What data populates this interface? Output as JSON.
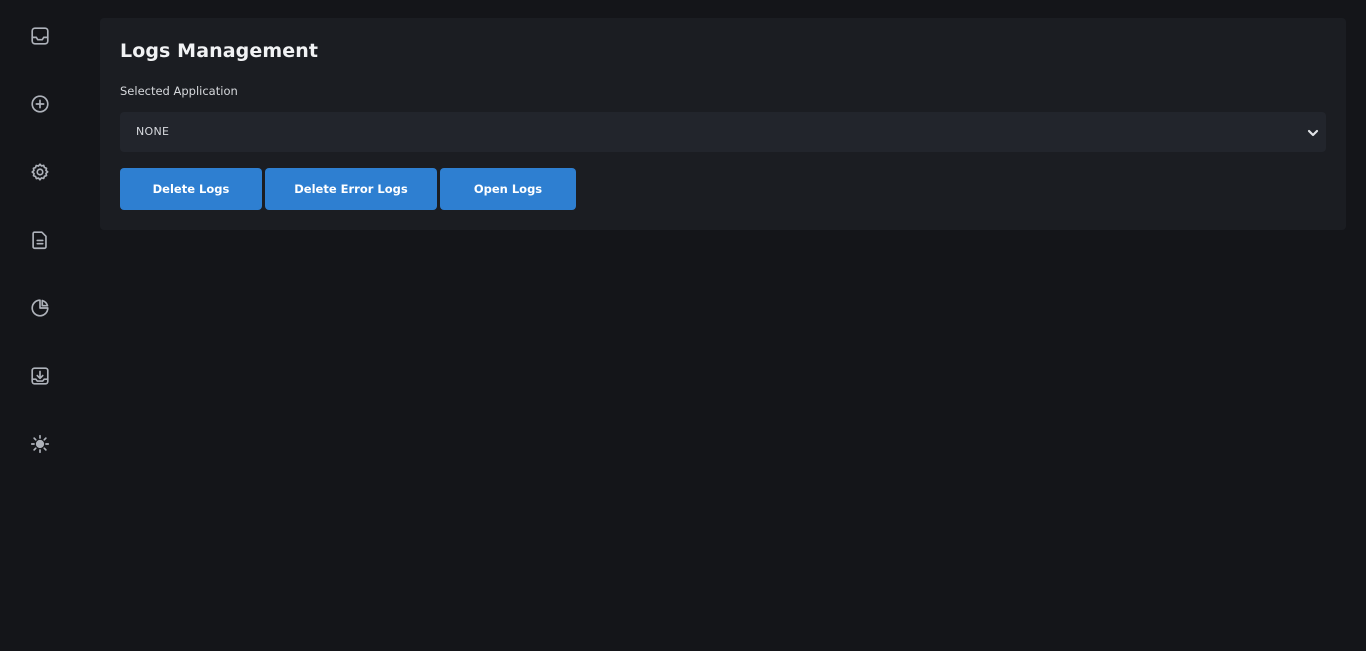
{
  "sidebar": {
    "items": [
      {
        "icon": "inbox-icon"
      },
      {
        "icon": "plus-circle-icon"
      },
      {
        "icon": "gear-icon"
      },
      {
        "icon": "document-icon"
      },
      {
        "icon": "pie-chart-icon"
      },
      {
        "icon": "download-tray-icon"
      },
      {
        "icon": "sun-icon"
      }
    ]
  },
  "panel": {
    "title": "Logs Management",
    "select_label": "Selected Application",
    "select_value": "NONE",
    "buttons": {
      "delete_logs": "Delete Logs",
      "delete_error_logs": "Delete Error Logs",
      "open_logs": "Open Logs"
    }
  },
  "colors": {
    "background": "#141519",
    "panel": "#1b1d22",
    "select": "#22252c",
    "accent": "#2e7fd1",
    "icon": "#aeb2ba"
  }
}
